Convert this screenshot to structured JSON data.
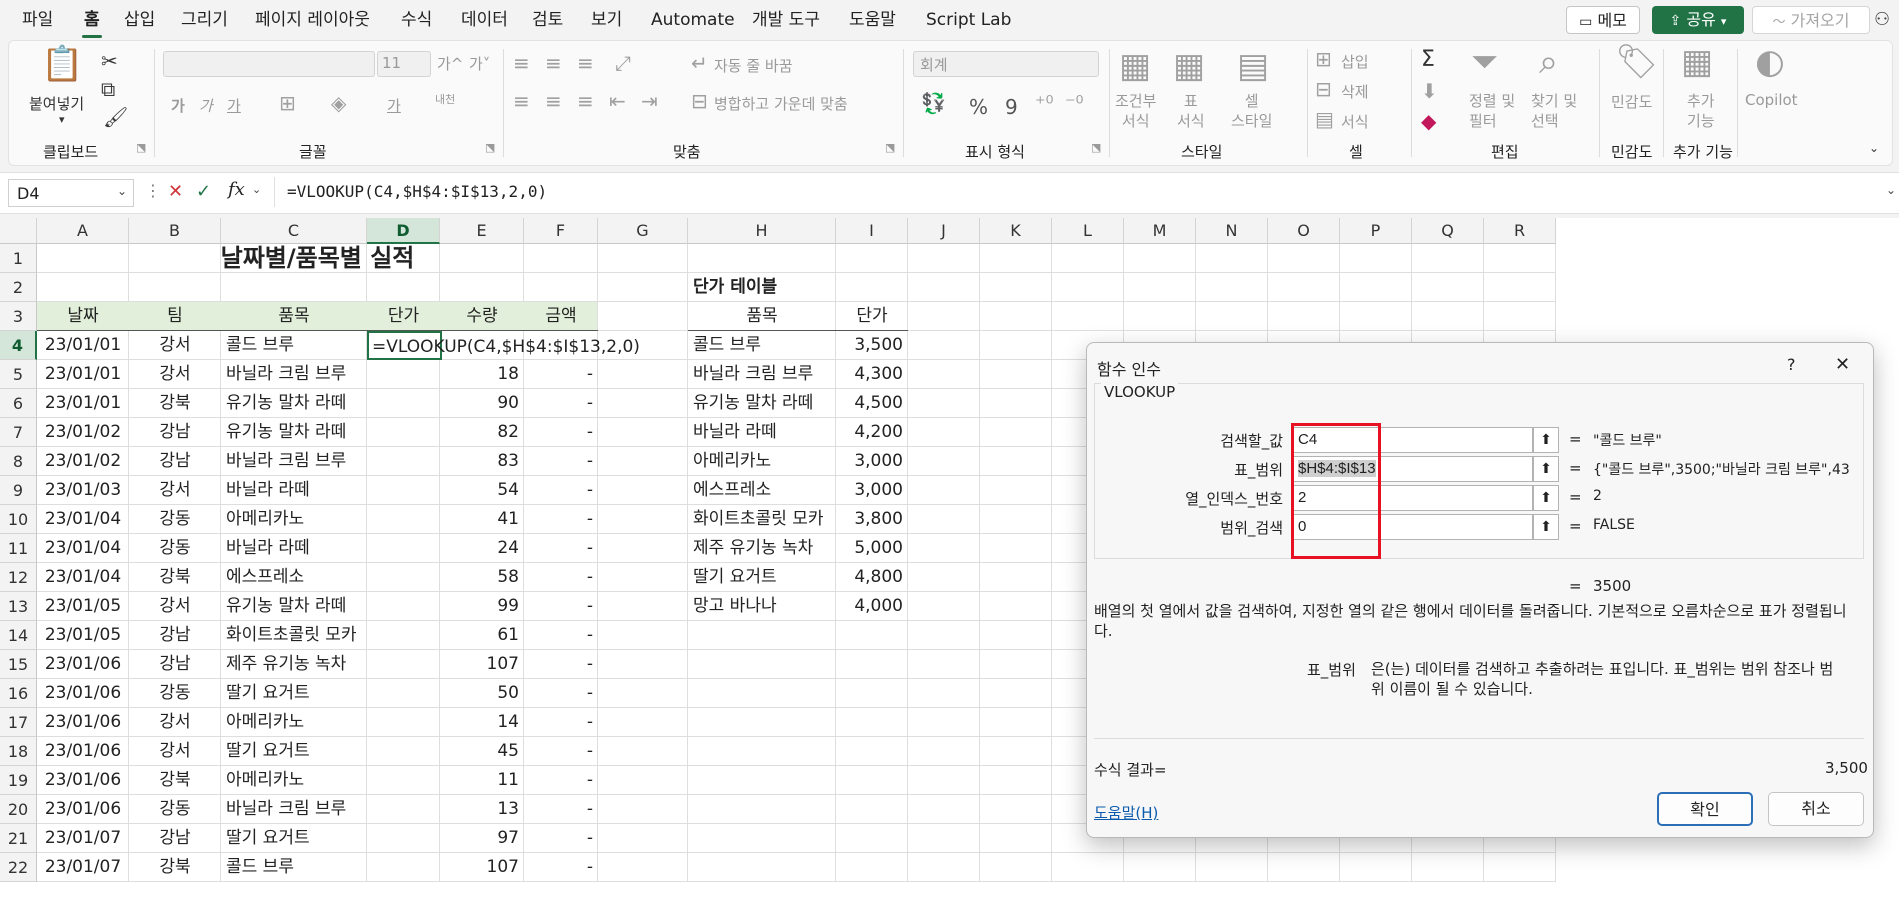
{
  "menubar": {
    "items": [
      "파일",
      "홈",
      "삽입",
      "그리기",
      "페이지 레이아웃",
      "수식",
      "데이터",
      "검토",
      "보기",
      "Automate",
      "개발 도구",
      "도움말",
      "Script Lab"
    ],
    "memo_label": "메모",
    "share_label": "공유",
    "get_label": "가져오기"
  },
  "ribbon": {
    "clipboard": {
      "paste_label": "붙여넣기",
      "group_label": "클립보드"
    },
    "font": {
      "size": "11",
      "grow": "가^",
      "shrink": "가˅",
      "bold": "가",
      "italic": "가",
      "underline": "가",
      "phonetic": "내천",
      "group_label": "글꼴"
    },
    "alignment": {
      "wrap_label": "자동 줄 바꿈",
      "merge_label": "병합하고 가운데 맞춤",
      "group_label": "맞춤"
    },
    "number": {
      "format": "회계",
      "percent": "%",
      "comma": "9",
      "group_label": "표시 형식"
    },
    "styles": {
      "conditional": "조건부\n서식",
      "table": "표\n서식",
      "cell_style": "셀\n스타일",
      "group_label": "스타일"
    },
    "cells": {
      "insert": "삽입",
      "delete": "삭제",
      "format": "서식",
      "group_label": "셀"
    },
    "editing": {
      "sum": "Σ",
      "sort": "정렬 및\n필터",
      "find": "찾기 및\n선택",
      "group_label": "편집"
    },
    "sensitivity": {
      "label": "민감도",
      "group_label": "민감도"
    },
    "addins": {
      "label": "추가\n기능",
      "group_label": "추가 기능"
    },
    "copilot": {
      "label": "Copilot"
    }
  },
  "formula_bar": {
    "name_box": "D4",
    "cancel": "✕",
    "enter": "✓",
    "fx": "fx",
    "formula": "=VLOOKUP(C4,$H$4:$I$13,2,0)"
  },
  "sheet": {
    "columns": [
      "A",
      "B",
      "C",
      "D",
      "E",
      "F",
      "G",
      "H",
      "I",
      "J",
      "K",
      "L",
      "M",
      "N",
      "O",
      "P",
      "Q",
      "R"
    ],
    "row_numbers": [
      "1",
      "2",
      "3",
      "4",
      "5",
      "6",
      "7",
      "8",
      "9",
      "10",
      "11",
      "12",
      "13",
      "14",
      "15",
      "16",
      "17",
      "18",
      "19",
      "20",
      "21",
      "22"
    ],
    "title": "날짜별/품목별 실적",
    "price_table_title": "단가 테이블",
    "headers": [
      "날짜",
      "팀",
      "품목",
      "단가",
      "수량",
      "금액"
    ],
    "price_headers": [
      "품목",
      "단가"
    ],
    "editing_formula": "=VLOOKUP(C4,$H$4:$I$13,2,0)",
    "rows": [
      [
        "23/01/01",
        "강서",
        "콜드 브루",
        "",
        "",
        ""
      ],
      [
        "23/01/01",
        "강서",
        "바닐라 크림 브루",
        "",
        "18",
        "-"
      ],
      [
        "23/01/01",
        "강북",
        "유기농 말차 라떼",
        "",
        "90",
        "-"
      ],
      [
        "23/01/02",
        "강남",
        "유기농 말차 라떼",
        "",
        "82",
        "-"
      ],
      [
        "23/01/02",
        "강남",
        "바닐라 크림 브루",
        "",
        "83",
        "-"
      ],
      [
        "23/01/03",
        "강서",
        "바닐라 라떼",
        "",
        "54",
        "-"
      ],
      [
        "23/01/04",
        "강동",
        "아메리카노",
        "",
        "41",
        "-"
      ],
      [
        "23/01/04",
        "강동",
        "바닐라 라떼",
        "",
        "24",
        "-"
      ],
      [
        "23/01/04",
        "강북",
        "에스프레소",
        "",
        "58",
        "-"
      ],
      [
        "23/01/05",
        "강서",
        "유기농 말차 라떼",
        "",
        "99",
        "-"
      ],
      [
        "23/01/05",
        "강남",
        "화이트초콜릿 모카",
        "",
        "61",
        "-"
      ],
      [
        "23/01/06",
        "강남",
        "제주 유기농 녹차",
        "",
        "107",
        "-"
      ],
      [
        "23/01/06",
        "강동",
        "딸기 요거트",
        "",
        "50",
        "-"
      ],
      [
        "23/01/06",
        "강서",
        "아메리카노",
        "",
        "14",
        "-"
      ],
      [
        "23/01/06",
        "강서",
        "딸기 요거트",
        "",
        "45",
        "-"
      ],
      [
        "23/01/06",
        "강북",
        "아메리카노",
        "",
        "11",
        "-"
      ],
      [
        "23/01/06",
        "강동",
        "바닐라 크림 브루",
        "",
        "13",
        "-"
      ],
      [
        "23/01/07",
        "강남",
        "딸기 요거트",
        "",
        "97",
        "-"
      ],
      [
        "23/01/07",
        "강북",
        "콜드 브루",
        "",
        "107",
        "-"
      ]
    ],
    "price_rows": [
      [
        "콜드 브루",
        "3,500"
      ],
      [
        "바닐라 크림 브루",
        "4,300"
      ],
      [
        "유기농 말차 라떼",
        "4,500"
      ],
      [
        "바닐라 라떼",
        "4,200"
      ],
      [
        "아메리카노",
        "3,000"
      ],
      [
        "에스프레소",
        "3,000"
      ],
      [
        "화이트초콜릿 모카",
        "3,800"
      ],
      [
        "제주 유기농 녹차",
        "5,000"
      ],
      [
        "딸기 요거트",
        "4,800"
      ],
      [
        "망고 바나나",
        "4,000"
      ]
    ]
  },
  "dialog": {
    "title": "함수 인수",
    "help_q": "?",
    "close": "✕",
    "function_name": "VLOOKUP",
    "args": [
      {
        "label": "검색할_값",
        "value": "C4",
        "result": "\"콜드 브루\""
      },
      {
        "label": "표_범위",
        "value": "$H$4:$I$13",
        "result": "{\"콜드 브루\",3500;\"바닐라 크림 브루\",43"
      },
      {
        "label": "열_인덱스_번호",
        "value": "2",
        "result": "2"
      },
      {
        "label": "범위_검색",
        "value": "0",
        "result": "FALSE"
      }
    ],
    "equals": "=",
    "total_result": "3500",
    "description": "배열의 첫 열에서 값을 검색하여, 지정한 열의 같은 행에서 데이터를 돌려줍니다. 기본적으로 오름차순으로 표가 정렬됩니다.",
    "arg_help_name": "표_범위",
    "arg_help_text": "은(는) 데이터를 검색하고 추출하려는 표입니다. 표_범위는 범위 참조나 범위 이름이 될 수 있습니다.",
    "formula_result_label": "수식 결과=",
    "formula_result_value": "3,500",
    "help_link": "도움말(H)",
    "ok_label": "확인",
    "cancel_label": "취소",
    "highlight_color": "#e81123"
  },
  "colors": {
    "accent": "#217346",
    "header_fill": "#e2efda",
    "share_button": "#217346"
  }
}
